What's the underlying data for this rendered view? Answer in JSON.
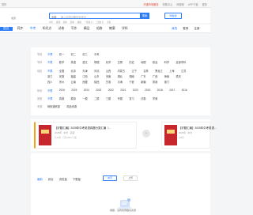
{
  "topbar": {
    "left": "您好",
    "right": [
      "开通市场服务",
      "帮助中心",
      "网校网",
      "APP下载",
      "更多"
    ]
  },
  "header": {
    "location": "北京",
    "search_select": "全部",
    "search_placeholder": "输入你感兴趣的关键字",
    "search_button": "搜索",
    "hotwords": [
      "中考",
      "真题",
      "期中",
      "期末",
      "模拟",
      "一轮复习",
      "二轮复习",
      "学案"
    ],
    "right_logo": "网校通"
  },
  "nav": {
    "items": [
      "首页",
      "同步",
      "中考",
      "知识点",
      "试卷",
      "写作",
      "精品",
      "组卷",
      "教案",
      "学科"
    ],
    "active": "中考",
    "right": [
      "我的",
      "登录",
      "注册"
    ]
  },
  "filters": [
    {
      "label": "学段",
      "values": [
        "不限",
        "初一",
        "初二",
        "初三",
        "中考"
      ],
      "selected": "不限"
    },
    {
      "label": "学科",
      "values": [
        "不限",
        "数学",
        "英语",
        "语文",
        "物理",
        "化学",
        "生物",
        "历史",
        "地理",
        "政治",
        "科学",
        "全部学科"
      ],
      "selected": "不限"
    },
    {
      "label": "地区",
      "values": [
        "不限",
        "全国",
        "北京",
        "天津",
        "河北",
        "山西",
        "内蒙古",
        "辽宁",
        "吉林",
        "黑龙江",
        "上海",
        "江苏"
      ],
      "selected": "不限"
    },
    {
      "label": "",
      "values": [
        "浙江",
        "安徽",
        "福建",
        "江西",
        "山东",
        "河南",
        "湖北",
        "湖南",
        "广东",
        "广西",
        "海南",
        "重庆"
      ],
      "selected": ""
    },
    {
      "label": "",
      "values": [
        "四川",
        "贵州",
        "云南",
        "西藏",
        "陕西",
        "甘肃",
        "青海",
        "宁夏",
        "新疆",
        "香港",
        "澳门"
      ],
      "selected": ""
    },
    {
      "label": "年份",
      "values": [
        "不限",
        "2026",
        "2025",
        "2024",
        "2023",
        "2022",
        "2021",
        "2020",
        "2019",
        "2018",
        "2017",
        "2016"
      ],
      "selected": "不限"
    },
    {
      "label": "类型",
      "values": [
        "不限",
        "真题",
        "模拟",
        "一模",
        "二模",
        "三模",
        "专题",
        "复习",
        "试卷",
        "学案"
      ],
      "selected": "不限"
    },
    {
      "label": "来源",
      "values": [
        "网校通资源",
        "精品资源"
      ],
      "selected": ""
    }
  ],
  "cards": [
    {
      "title": "【好题汇编】2025年中考英语真题分类汇编（...",
      "meta": "2025年 · 中考 · 英语",
      "tags": "共12份 · 已有128人下载"
    },
    {
      "title": "【好题汇编】2025年中考英语...",
      "meta": "2025年 · 中考",
      "tags": "共8份"
    }
  ],
  "list": {
    "tabs": [
      "最新",
      "综合",
      "浏览量",
      "下载量"
    ],
    "selected_tab": "最新",
    "buttons": [
      "本页",
      "上传"
    ]
  },
  "empty": {
    "text": "抱歉，没有找到相关资源"
  }
}
